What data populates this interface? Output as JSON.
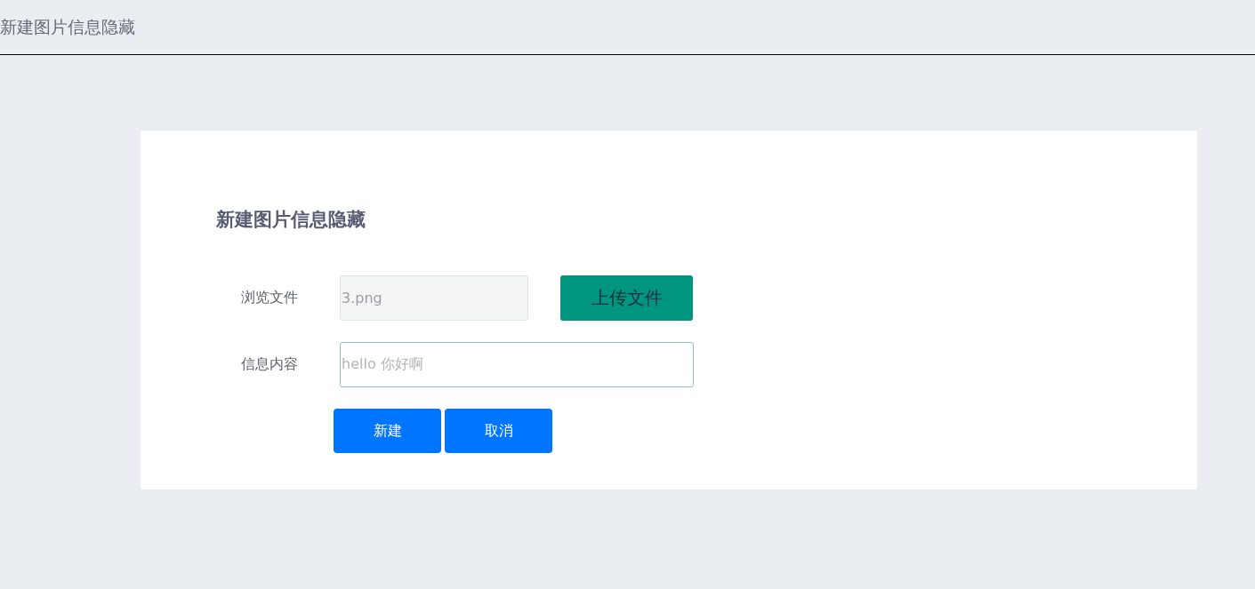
{
  "header": {
    "title": "新建图片信息隐藏"
  },
  "form": {
    "heading": "新建图片信息隐藏",
    "fields": [
      {
        "kind": "file",
        "label": "浏览文件",
        "value": "3.png",
        "disabled": true,
        "button": "上传文件"
      },
      {
        "kind": "text",
        "label": "信息内容",
        "value": "hello 你好啊",
        "disabled": false
      }
    ],
    "actions": [
      "新建",
      "取消"
    ]
  }
}
